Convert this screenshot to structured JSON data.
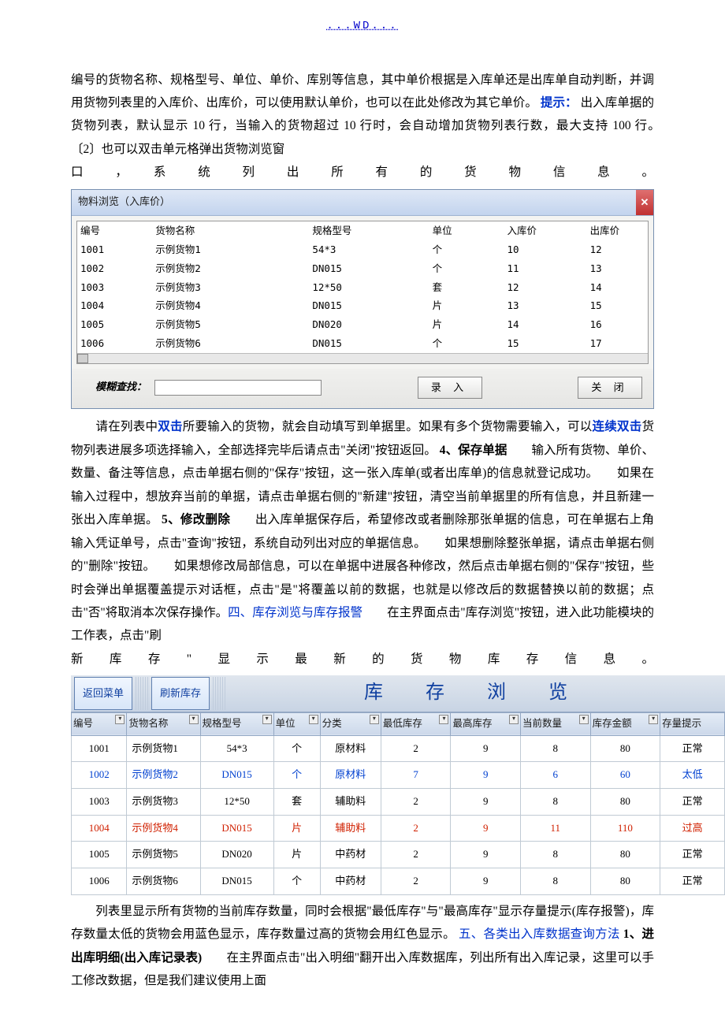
{
  "header_link": "...WD...",
  "para1": "编号的货物名称、规格型号、单位、单价、库别等信息，其中单价根据是入库单还是出库单自动判断，并调用货物列表里的入库价、出库价，可以使用默认单价，也可以在此处修改为其它单价。",
  "tip_label": "提示：",
  "para1b": "出入库单据的货物列表，默认显示 10 行，当输入的货物超过 10 行时，会自动增加货物列表行数，最大支持 100 行。　　〔2〕也可以双击单元格弹出货物浏览窗",
  "para1c": "口　，　系　统　列　出　所　有　的　货　物　信　息　。",
  "dialog": {
    "title": "物料浏览（入库价）",
    "headers": [
      "编号",
      "货物名称",
      "规格型号",
      "单位",
      "入库价",
      "出库价"
    ],
    "rows": [
      [
        "1001",
        "示例货物1",
        "54*3",
        "个",
        "10",
        "12"
      ],
      [
        "1002",
        "示例货物2",
        "DN015",
        "个",
        "11",
        "13"
      ],
      [
        "1003",
        "示例货物3",
        "12*50",
        "套",
        "12",
        "14"
      ],
      [
        "1004",
        "示例货物4",
        "DN015",
        "片",
        "13",
        "15"
      ],
      [
        "1005",
        "示例货物5",
        "DN020",
        "片",
        "14",
        "16"
      ],
      [
        "1006",
        "示例货物6",
        "DN015",
        "个",
        "15",
        "17"
      ]
    ],
    "search_label": "模糊查找：",
    "btn_enter": "录 入",
    "btn_close": "关 闭"
  },
  "para2a": "　　请在列表中",
  "dbl_click": "双击",
  "para2b": "所要输入的货物，就会自动填写到单据里。如果有多个货物需要输入，可以",
  "cont_click": "连续双击",
  "para2c": "货物列表进展多项选择输入，全部选择完毕后请点击\"关闭\"按钮返回。",
  "h4": "4、保存单据",
  "para3": "　　输入所有货物、单价、数量、备注等信息，点击单据右侧的\"保存\"按钮，这一张入库单(或者出库单)的信息就登记成功。　　如果在输入过程中，想放弃当前的单据，请点击单据右侧的\"新建\"按钮，清空当前单据里的所有信息，并且新建一张出入库单据。",
  "h5": "5、修改删除",
  "para4": "　　出入库单据保存后，希望修改或者删除那张单据的信息，可在单据右上角输入凭证单号，点击\"查询\"按钮，系统自动列出对应的单据信息。　　如果想删除整张单据，请点击单据右侧的\"删除\"按钮。　　如果想修改局部信息，可以在单据中进展各种修改，然后点击单据右侧的\"保存\"按钮，些时会弹出单据覆盖提示对话框，点击\"是\"将覆盖以前的数据，也就是以修改后的数据替换以前的数据；点击\"否\"将取消本次保存操作。",
  "h_sec4": "四、库存浏览与库存报警",
  "para5": "　　在主界面点击\"库存浏览\"按钮，进入此功能模块的工作表，点击\"刷",
  "para5b": "新　库　存　\"　显　示　最　新　的　货　物　库　存　信　息　。",
  "inventory": {
    "btn_back": "返回菜单",
    "btn_refresh": "刷新库存",
    "title": "库 存 浏 览",
    "columns": [
      "编号",
      "货物名称",
      "规格型号",
      "单位",
      "分类",
      "最低库存",
      "最高库存",
      "当前数量",
      "库存金额",
      "存量提示"
    ],
    "rows": [
      {
        "style": "",
        "cells": [
          "1001",
          "示例货物1",
          "54*3",
          "个",
          "原材料",
          "2",
          "9",
          "8",
          "80",
          "正常"
        ]
      },
      {
        "style": "blue",
        "cells": [
          "1002",
          "示例货物2",
          "DN015",
          "个",
          "原材料",
          "7",
          "9",
          "6",
          "60",
          "太低"
        ]
      },
      {
        "style": "",
        "cells": [
          "1003",
          "示例货物3",
          "12*50",
          "套",
          "辅助料",
          "2",
          "9",
          "8",
          "80",
          "正常"
        ]
      },
      {
        "style": "red",
        "cells": [
          "1004",
          "示例货物4",
          "DN015",
          "片",
          "辅助料",
          "2",
          "9",
          "11",
          "110",
          "过高"
        ]
      },
      {
        "style": "",
        "cells": [
          "1005",
          "示例货物5",
          "DN020",
          "片",
          "中药材",
          "2",
          "9",
          "8",
          "80",
          "正常"
        ]
      },
      {
        "style": "",
        "cells": [
          "1006",
          "示例货物6",
          "DN015",
          "个",
          "中药材",
          "2",
          "9",
          "8",
          "80",
          "正常"
        ]
      }
    ]
  },
  "para6": "　　列表里显示所有货物的当前库存数量，同时会根据\"最低库存\"与\"最高库存\"显示存量提示(库存报警)，库存数量太低的货物会用蓝色显示，库存数量过高的货物会用红色显示。",
  "h_sec5": "五、各类出入库数据查询方法",
  "h_sec5_1": " 1、进出库明细(出入库记录表)",
  "para7": "　　在主界面点击\"出入明细\"翻开出入库数据库，列出所有出入库记录，这里可以手工修改数据，但是我们建议使用上面"
}
